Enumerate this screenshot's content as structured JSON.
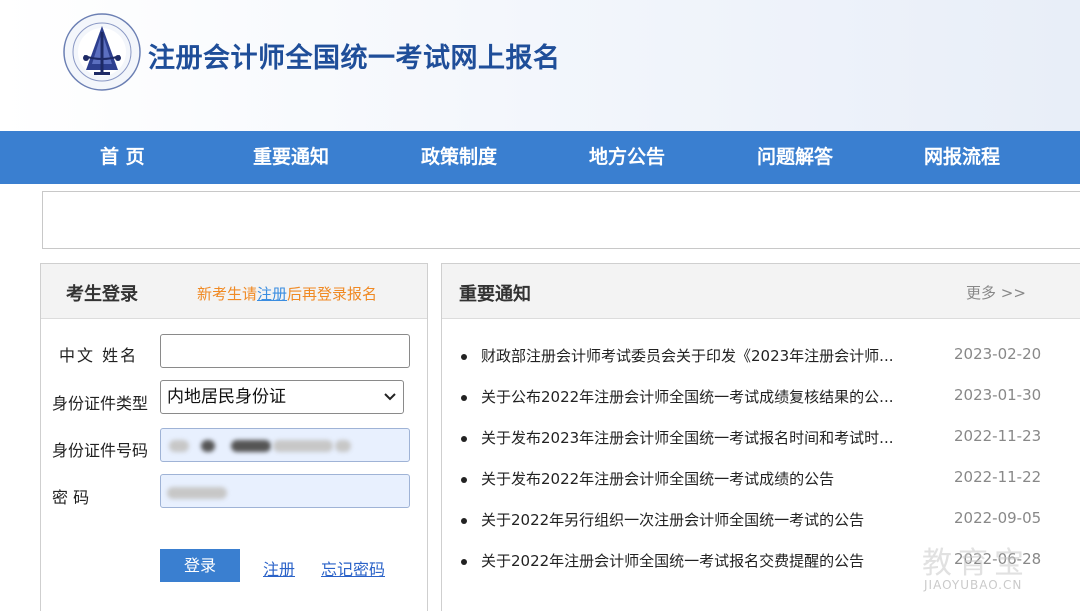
{
  "header": {
    "site_title": "注册会计师全国统一考试网上报名",
    "logo_icon": "cicpa-emblem-logo"
  },
  "nav": {
    "items": [
      {
        "label": "首 页"
      },
      {
        "label": "重要通知"
      },
      {
        "label": "政策制度"
      },
      {
        "label": "地方公告"
      },
      {
        "label": "问题解答"
      },
      {
        "label": "网报流程"
      }
    ]
  },
  "login": {
    "title": "考生登录",
    "note_prefix": "新考生请",
    "note_link": "注册",
    "note_suffix": "后再登录报名",
    "name_label": "中文  姓名",
    "name_value": "",
    "id_type_label": "身份证件类型",
    "id_type_value": "内地居民身份证",
    "id_number_label": "身份证件号码",
    "password_label": "密        码",
    "login_button": "登录",
    "register_link": "注册",
    "forgot_link": "忘记密码"
  },
  "notices": {
    "title": "重要通知",
    "more": "更多 >>",
    "items": [
      {
        "text": "财政部注册会计师考试委员会关于印发《2023年注册会计师...",
        "date": "2023-02-20"
      },
      {
        "text": "关于公布2022年注册会计师全国统一考试成绩复核结果的公...",
        "date": "2023-01-30"
      },
      {
        "text": "关于发布2023年注册会计师全国统一考试报名时间和考试时...",
        "date": "2022-11-23"
      },
      {
        "text": "关于发布2022年注册会计师全国统一考试成绩的公告",
        "date": "2022-11-22"
      },
      {
        "text": "关于2022年另行组织一次注册会计师全国统一考试的公告",
        "date": "2022-09-05"
      },
      {
        "text": "关于2022年注册会计师全国统一考试报名交费提醒的公告",
        "date": "2022-06-28"
      }
    ]
  },
  "watermark": {
    "cn": "教育宝",
    "en": "JIAOYUBAO.CN"
  },
  "colors": {
    "nav_bg": "#3a7fd0",
    "title": "#1f4e99",
    "note_orange": "#f08a24"
  }
}
